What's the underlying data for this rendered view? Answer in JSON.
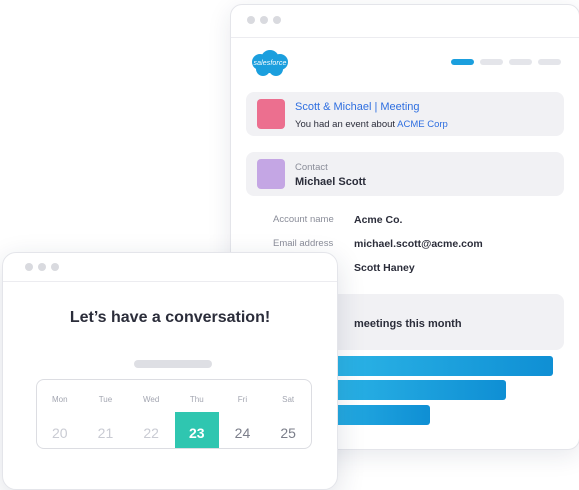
{
  "crm": {
    "logo_text": "salesforce",
    "event": {
      "title": "Scott & Michael | Meeting",
      "text": "You had an event about",
      "company": "ACME Corp"
    },
    "contact": {
      "label": "Contact",
      "name": "Michael Scott"
    },
    "fields": [
      {
        "label": "Account name",
        "value": "Acme Co."
      },
      {
        "label": "Email address",
        "value": "michael.scott@acme.com"
      },
      {
        "label": "",
        "value": "Scott Haney"
      }
    ],
    "meetings_text": "meetings this month",
    "meeting_bars": [
      1.0,
      0.84,
      0.58
    ],
    "colors": {
      "accent": "#1b9fde",
      "event_square": "#ec6f8f",
      "contact_square": "#c4a6e4"
    }
  },
  "scheduler": {
    "title": "Let’s have a conversation!",
    "days": [
      {
        "day": "Mon",
        "date": "20",
        "state": "past"
      },
      {
        "day": "Tue",
        "date": "21",
        "state": "past"
      },
      {
        "day": "Wed",
        "date": "22",
        "state": "past"
      },
      {
        "day": "Thu",
        "date": "23",
        "state": "selected"
      },
      {
        "day": "Fri",
        "date": "24",
        "state": "future"
      },
      {
        "day": "Sat",
        "date": "25",
        "state": "future"
      }
    ],
    "colors": {
      "selected": "#2fc6b0"
    }
  }
}
